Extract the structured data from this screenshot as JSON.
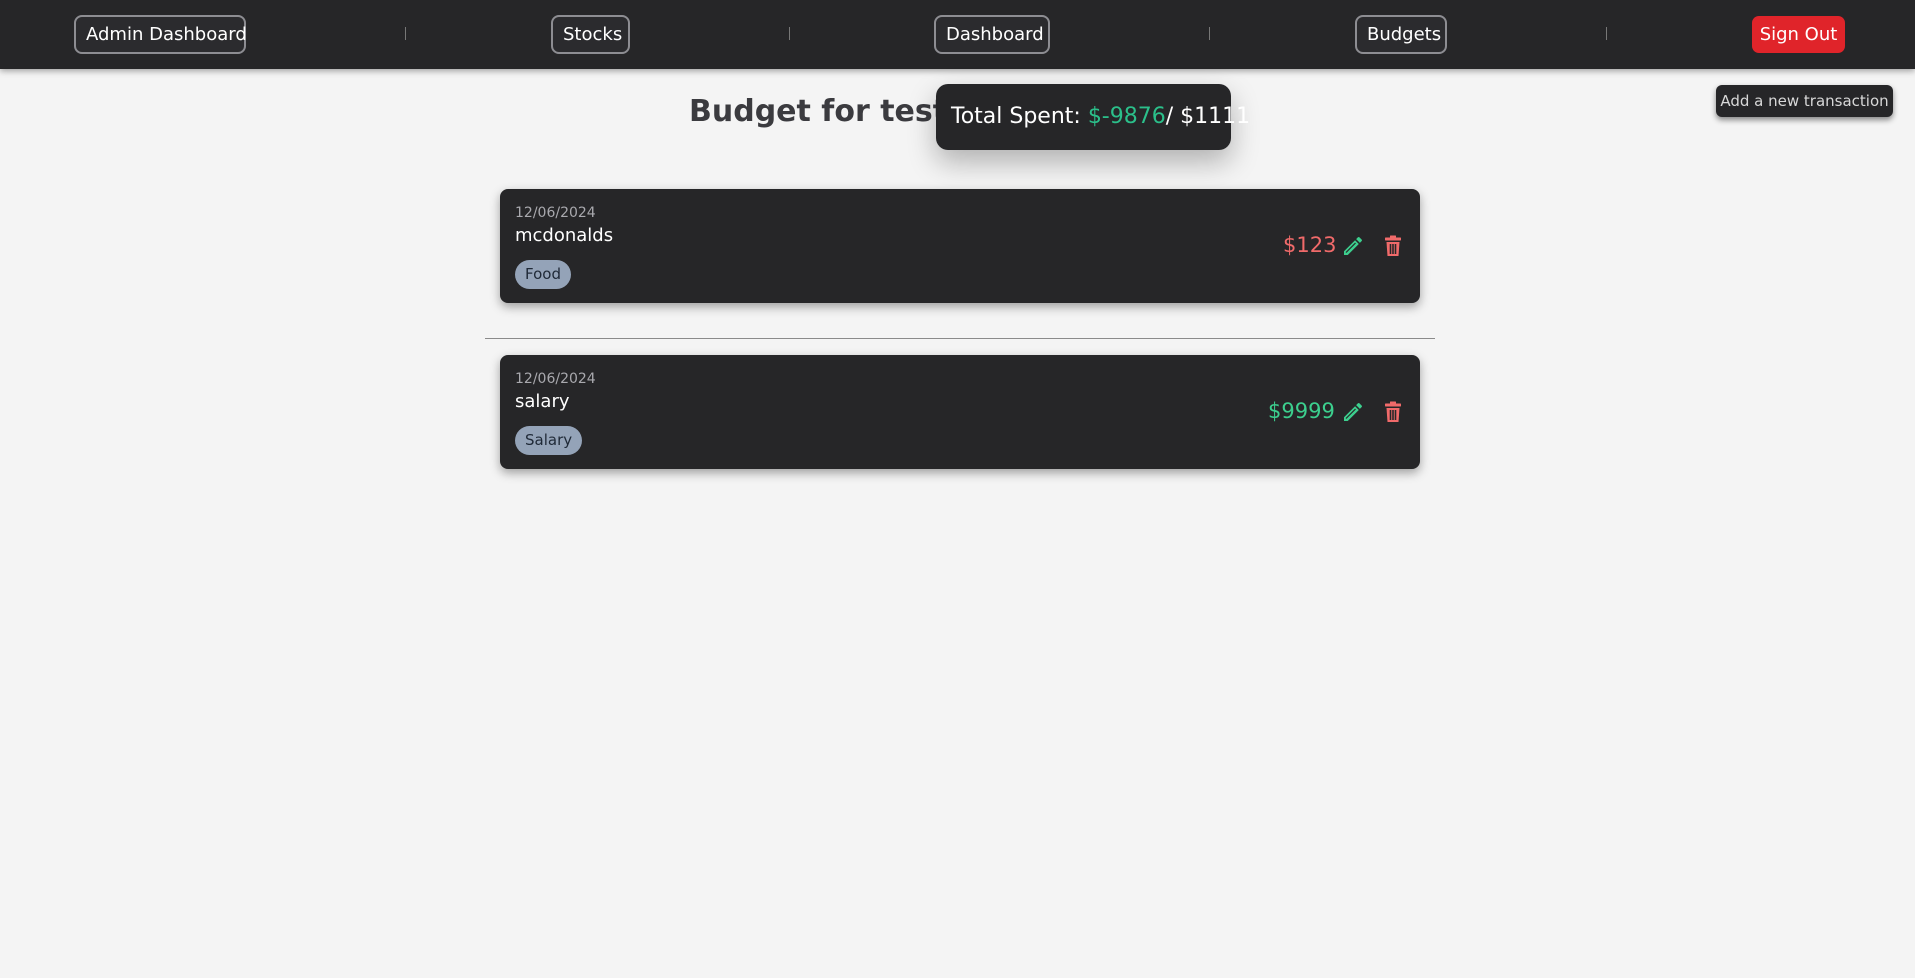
{
  "nav": {
    "admin_dashboard": "Admin Dashboard",
    "stocks": "Stocks",
    "dashboard": "Dashboard",
    "budgets": "Budgets",
    "sign_out": "Sign Out"
  },
  "actions": {
    "add_transaction": "Add a new transaction"
  },
  "header": {
    "title": "Budget for test",
    "total_label": "Total Spent: ",
    "total_spent": "$-9876",
    "total_budget": "/ $1111"
  },
  "transactions": [
    {
      "date": "12/06/2024",
      "name": "mcdonalds",
      "category": "Food",
      "amount": "$123",
      "amount_color": "#f06a6a"
    },
    {
      "date": "12/06/2024",
      "name": "salary",
      "category": "Salary",
      "amount": "$9999",
      "amount_color": "#3ccf8e"
    }
  ],
  "icons": {
    "edit": "pencil-icon",
    "delete": "trash-icon"
  },
  "colors": {
    "navbar": "#262628",
    "sign_out": "#e0242a",
    "spent": "#2bbf8a",
    "edit_icon": "#3ccf8e",
    "delete_icon": "#f06a6a",
    "tag_bg": "#94a3b8"
  }
}
